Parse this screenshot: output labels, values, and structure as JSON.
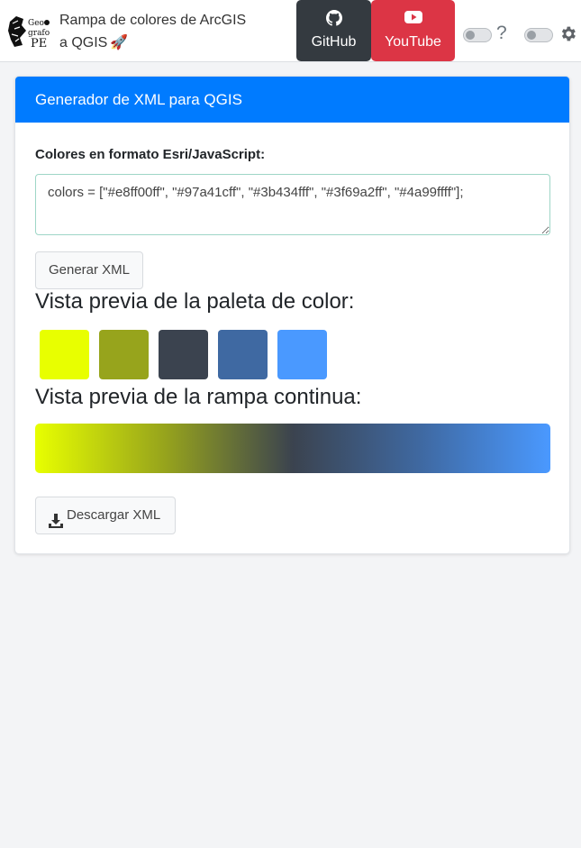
{
  "navbar": {
    "logo_text": [
      "Geo",
      "grafo",
      "PE"
    ],
    "title_line1": "Rampa de colores de ArcGIS",
    "title_line2": "a QGIS",
    "title_emoji": "🚀",
    "github_label": "GitHub",
    "youtube_label": "YouTube",
    "help_glyph": "?",
    "icons": [
      "github-icon",
      "youtube-icon",
      "help-icon",
      "gear-icon"
    ],
    "toggles": [
      {
        "state": "off"
      },
      {
        "state": "off"
      }
    ]
  },
  "card": {
    "header": "Generador de XML para QGIS",
    "field_label": "Colores en formato Esri/JavaScript:",
    "input_value": "colors = [\"#e8ff00ff\", \"#97a41cff\", \"#3b434fff\", \"#3f69a2ff\", \"#4a99ffff\"];",
    "generate_label": "Generar XML",
    "palette_title": "Vista previa de la paleta de color:",
    "ramp_title": "Vista previa de la rampa continua:",
    "download_label": "Descargar XML"
  },
  "colors": {
    "palette": [
      "#e8ff00",
      "#97a41c",
      "#3b434f",
      "#3f69a2",
      "#4a99ff"
    ],
    "header_bg": "#007bff",
    "github_bg": "#343a40",
    "youtube_bg": "#dc3545",
    "page_bg": "#f3f4f6"
  }
}
